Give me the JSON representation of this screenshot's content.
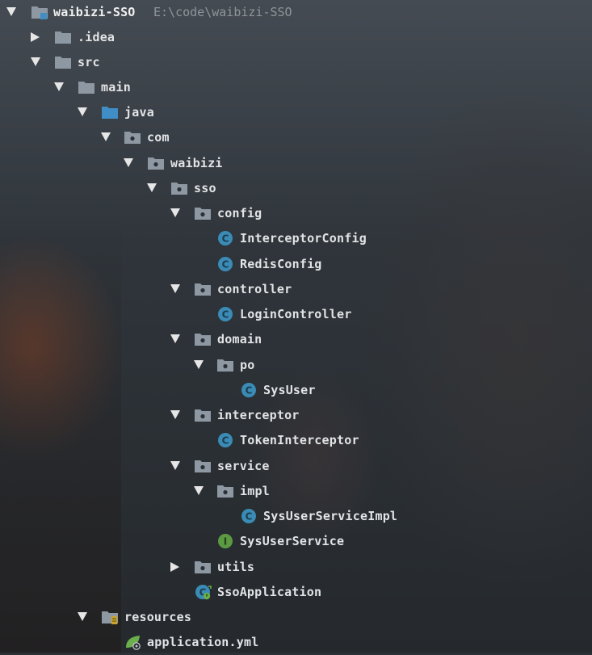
{
  "project_tree": {
    "root": {
      "name": "waibizi-SSO",
      "path": "E:\\code\\waibizi-SSO"
    },
    "items": [
      {
        "label": "waibizi-SSO",
        "icon": "module-folder-icon"
      },
      {
        "label": ".idea",
        "icon": "folder-icon",
        "expanded": false
      },
      {
        "label": "src",
        "icon": "folder-icon",
        "expanded": true
      },
      {
        "label": "main",
        "icon": "folder-icon",
        "expanded": true
      },
      {
        "label": "java",
        "icon": "source-folder-icon",
        "expanded": true
      },
      {
        "label": "com",
        "icon": "package-icon",
        "expanded": true
      },
      {
        "label": "waibizi",
        "icon": "package-icon",
        "expanded": true
      },
      {
        "label": "sso",
        "icon": "package-icon",
        "expanded": true
      },
      {
        "label": "config",
        "icon": "package-icon",
        "expanded": true
      },
      {
        "label": "InterceptorConfig",
        "icon": "class-icon"
      },
      {
        "label": "RedisConfig",
        "icon": "class-icon"
      },
      {
        "label": "controller",
        "icon": "package-icon",
        "expanded": true
      },
      {
        "label": "LoginController",
        "icon": "class-icon"
      },
      {
        "label": "domain",
        "icon": "package-icon",
        "expanded": true
      },
      {
        "label": "po",
        "icon": "package-icon",
        "expanded": true
      },
      {
        "label": "SysUser",
        "icon": "class-icon"
      },
      {
        "label": "interceptor",
        "icon": "package-icon",
        "expanded": true
      },
      {
        "label": "TokenInterceptor",
        "icon": "class-icon"
      },
      {
        "label": "service",
        "icon": "package-icon",
        "expanded": true
      },
      {
        "label": "impl",
        "icon": "package-icon",
        "expanded": true
      },
      {
        "label": "SysUserServiceImpl",
        "icon": "class-icon"
      },
      {
        "label": "SysUserService",
        "icon": "interface-icon"
      },
      {
        "label": "utils",
        "icon": "package-icon",
        "expanded": false
      },
      {
        "label": "SsoApplication",
        "icon": "spring-boot-class-icon"
      },
      {
        "label": "resources",
        "icon": "resources-folder-icon",
        "expanded": true
      },
      {
        "label": "application.yml",
        "icon": "spring-yml-icon"
      }
    ]
  },
  "colors": {
    "text": "#e2e4e6",
    "path_text": "#8f959b",
    "folder": "#8e98a2",
    "source_folder": "#3f8fc6",
    "class_badge": "#3a8bb5",
    "interface_badge": "#5b9a43",
    "spring": "#6aaf4b"
  }
}
